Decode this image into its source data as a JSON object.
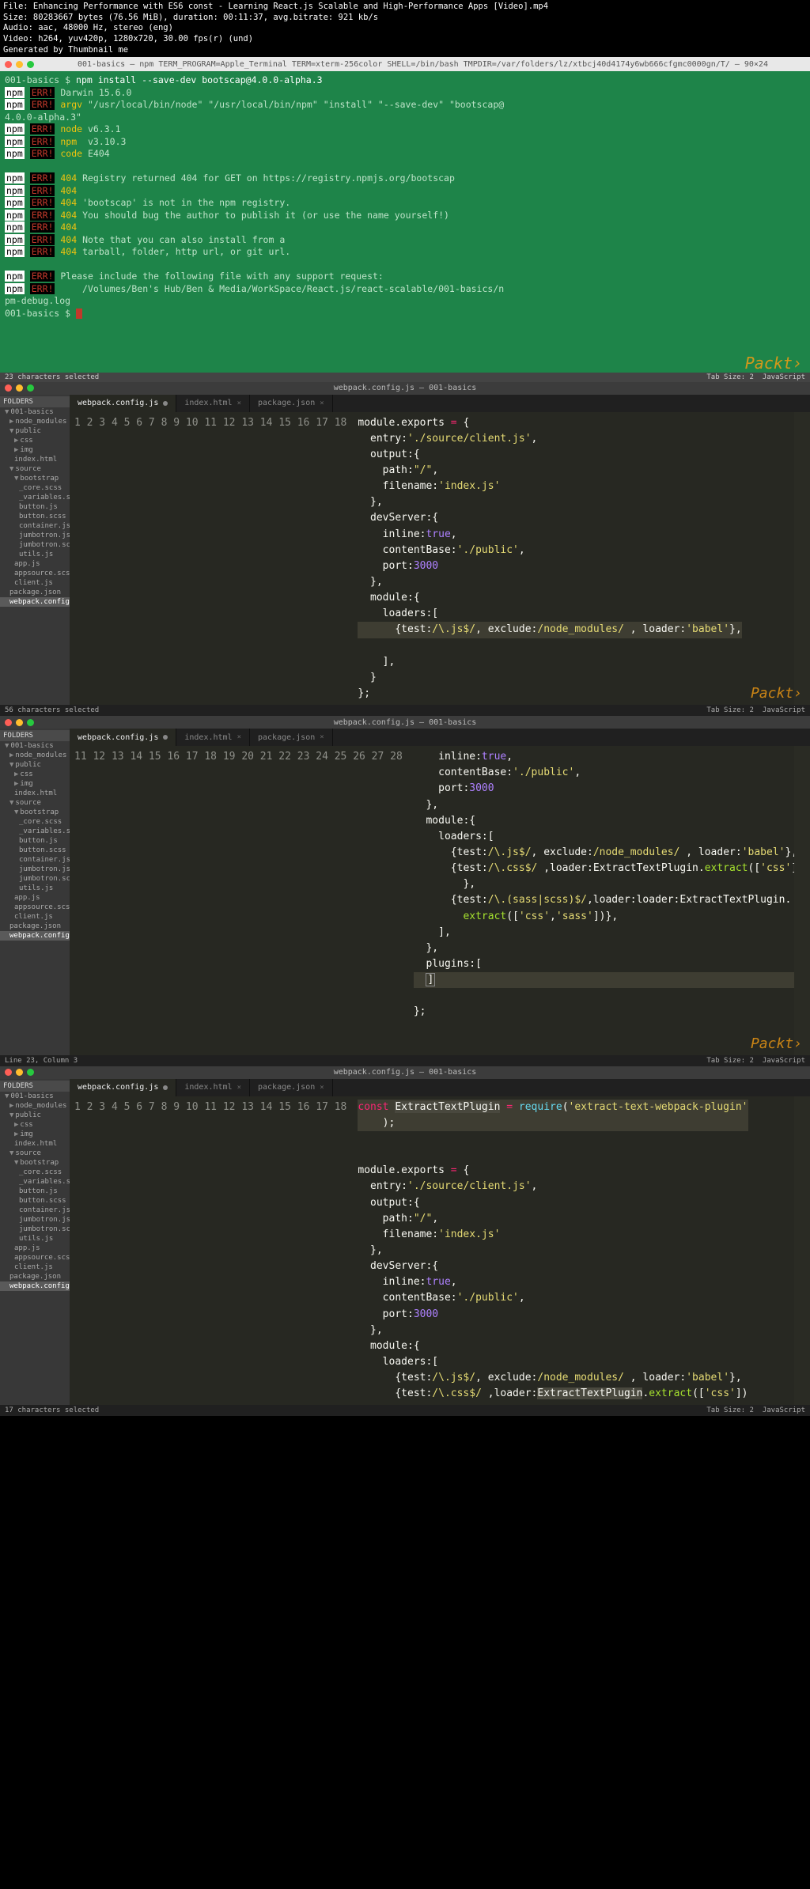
{
  "header": {
    "file": "File: Enhancing Performance with ES6 const - Learning React.js Scalable and High-Performance Apps [Video].mp4",
    "size": "Size: 80283667 bytes (76.56 MiB), duration: 00:11:37, avg.bitrate: 921 kb/s",
    "audio": "Audio: aac, 48000 Hz, stereo (eng)",
    "video": "Video: h264, yuv420p, 1280x720, 30.00 fps(r) (und)",
    "gen": "Generated by Thumbnail me"
  },
  "terminal": {
    "title": "001-basics — npm TERM_PROGRAM=Apple_Terminal TERM=xterm-256color SHELL=/bin/bash TMPDIR=/var/folders/lz/xtbcj40d4174y6wb666cfgmc0000gn/T/ — 90×24",
    "prompt1": "001-basics $ ",
    "cmd1": "npm install --save-dev bootscap@4.0.0-alpha.3",
    "l1": "Darwin 15.6.0",
    "l2a": "argv",
    "l2b": " \"/usr/local/bin/node\" \"/usr/local/bin/npm\" \"install\" \"--save-dev\" \"bootscap@",
    "l2c": "4.0.0-alpha.3\"",
    "l3a": "node",
    "l3b": " v6.3.1",
    "l4a": "npm ",
    "l4b": " v3.10.3",
    "l5a": "code",
    "l5b": " E404",
    "l6": "Registry returned 404 for GET on https://registry.npmjs.org/bootscap",
    "l7": "",
    "l8": "'bootscap' is not in the npm registry.",
    "l9": "You should bug the author to publish it (or use the name yourself!)",
    "l10": "",
    "l11": "Note that you can also install from a",
    "l12": "tarball, folder, http url, or git url.",
    "l13": "Please include the following file with any support request:",
    "l14": "    /Volumes/Ben's Hub/Ben & Media/WorkSpace/React.js/react-scalable/001-basics/n",
    "l15": "pm-debug.log",
    "prompt2": "001-basics $ ",
    "status_left": "23 characters selected",
    "status_right_tab": "Tab Size: 2",
    "status_right_lang": "JavaScript",
    "packt": "Packt›"
  },
  "sidebar": {
    "head": "FOLDERS",
    "items": [
      {
        "t": "001-basics",
        "i": 0,
        "a": "▼"
      },
      {
        "t": "node_modules",
        "i": 1,
        "a": "▶"
      },
      {
        "t": "public",
        "i": 1,
        "a": "▼"
      },
      {
        "t": "css",
        "i": 2,
        "a": "▶"
      },
      {
        "t": "img",
        "i": 2,
        "a": "▶"
      },
      {
        "t": "index.html",
        "i": 2,
        "a": ""
      },
      {
        "t": "source",
        "i": 1,
        "a": "▼"
      },
      {
        "t": "bootstrap",
        "i": 2,
        "a": "▼"
      },
      {
        "t": "_core.scss",
        "i": 3,
        "a": ""
      },
      {
        "t": "_variables.scss",
        "i": 3,
        "a": ""
      },
      {
        "t": "button.js",
        "i": 3,
        "a": ""
      },
      {
        "t": "button.scss",
        "i": 3,
        "a": ""
      },
      {
        "t": "container.js",
        "i": 3,
        "a": ""
      },
      {
        "t": "jumbotron.js",
        "i": 3,
        "a": ""
      },
      {
        "t": "jumbotron.scss",
        "i": 3,
        "a": ""
      },
      {
        "t": "utils.js",
        "i": 3,
        "a": ""
      },
      {
        "t": "app.js",
        "i": 2,
        "a": ""
      },
      {
        "t": "appsource.scss",
        "i": 2,
        "a": ""
      },
      {
        "t": "client.js",
        "i": 2,
        "a": ""
      },
      {
        "t": "package.json",
        "i": 1,
        "a": ""
      },
      {
        "t": "webpack.config.js",
        "i": 1,
        "a": "",
        "active": true
      }
    ]
  },
  "editor1": {
    "title": "webpack.config.js — 001-basics",
    "tabs": [
      {
        "l": "webpack.config.js",
        "a": true,
        "m": true
      },
      {
        "l": "index.html"
      },
      {
        "l": "package.json"
      }
    ],
    "status_left": "56 characters selected",
    "status_right_tab": "Tab Size: 2",
    "status_right_lang": "JavaScript",
    "packt": "Packt›",
    "lines": [
      1,
      2,
      3,
      4,
      5,
      6,
      7,
      8,
      9,
      10,
      11,
      12,
      13,
      14,
      15,
      16,
      17,
      18
    ]
  },
  "editor2": {
    "title": "webpack.config.js — 001-basics",
    "tabs": [
      {
        "l": "webpack.config.js",
        "a": true,
        "m": true
      },
      {
        "l": "index.html"
      },
      {
        "l": "package.json"
      }
    ],
    "status_left": "Line 23, Column 3",
    "status_right_tab": "Tab Size: 2",
    "status_right_lang": "JavaScript",
    "packt": "Packt›",
    "lines": [
      11,
      12,
      13,
      14,
      15,
      16,
      17,
      18,
      19,
      20,
      21,
      22,
      23,
      24,
      25,
      26,
      27,
      28
    ]
  },
  "editor3": {
    "title": "webpack.config.js — 001-basics",
    "tabs": [
      {
        "l": "webpack.config.js",
        "a": true,
        "m": true
      },
      {
        "l": "index.html"
      },
      {
        "l": "package.json"
      }
    ],
    "status_left": "17 characters selected",
    "status_right_tab": "Tab Size: 2",
    "status_right_lang": "JavaScript",
    "packt": "Packt›",
    "lines": [
      1,
      2,
      3,
      4,
      5,
      6,
      7,
      8,
      9,
      10,
      11,
      12,
      13,
      14,
      15,
      16,
      17,
      18
    ]
  }
}
